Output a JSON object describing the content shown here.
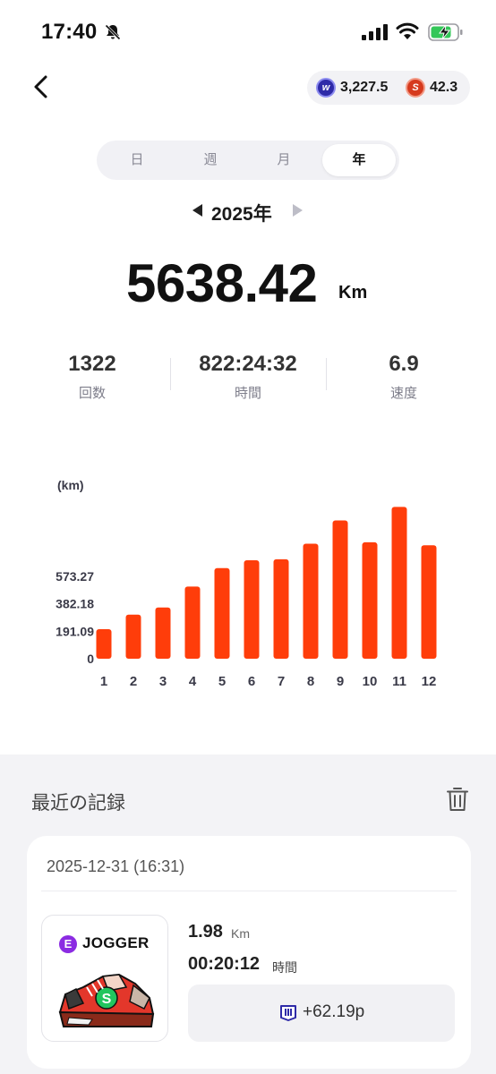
{
  "status_bar": {
    "time": "17:40"
  },
  "header": {
    "w_points": "3,227.5",
    "s_points": "42.3",
    "w_coin_glyph": "w",
    "s_coin_glyph": "S"
  },
  "period_tabs": [
    {
      "label": "日",
      "active": false
    },
    {
      "label": "週",
      "active": false
    },
    {
      "label": "月",
      "active": false
    },
    {
      "label": "年",
      "active": true
    }
  ],
  "year_selector": {
    "label": "2025年"
  },
  "summary": {
    "total_distance": "5638.42",
    "total_unit": "Km",
    "stats": [
      {
        "value": "1322",
        "label": "回数"
      },
      {
        "value": "822:24:32",
        "label": "時間"
      },
      {
        "value": "6.9",
        "label": "速度"
      }
    ]
  },
  "chart_data": {
    "type": "bar",
    "unit_label": "(km)",
    "categories": [
      "1",
      "2",
      "3",
      "4",
      "5",
      "6",
      "7",
      "8",
      "9",
      "10",
      "11",
      "12"
    ],
    "values": [
      206,
      307,
      357,
      503,
      631,
      686,
      693,
      801,
      963,
      811,
      1058,
      790
    ],
    "y_ticks": [
      "0",
      "191.09",
      "382.18",
      "573.27"
    ],
    "y_tick_values": [
      0,
      191.09,
      382.18,
      573.27
    ],
    "ylim": [
      0,
      1060
    ],
    "bar_color": "#ff3d0a"
  },
  "recent": {
    "title": "最近の記録",
    "records": [
      {
        "date": "2025-12-31 (16:31)",
        "shoe_badge": "E",
        "shoe_brand": "JOGGER",
        "distance": "1.98",
        "distance_unit": "Km",
        "duration": "00:20:12",
        "duration_unit": "時間",
        "reward": "+62.19p"
      }
    ]
  }
}
